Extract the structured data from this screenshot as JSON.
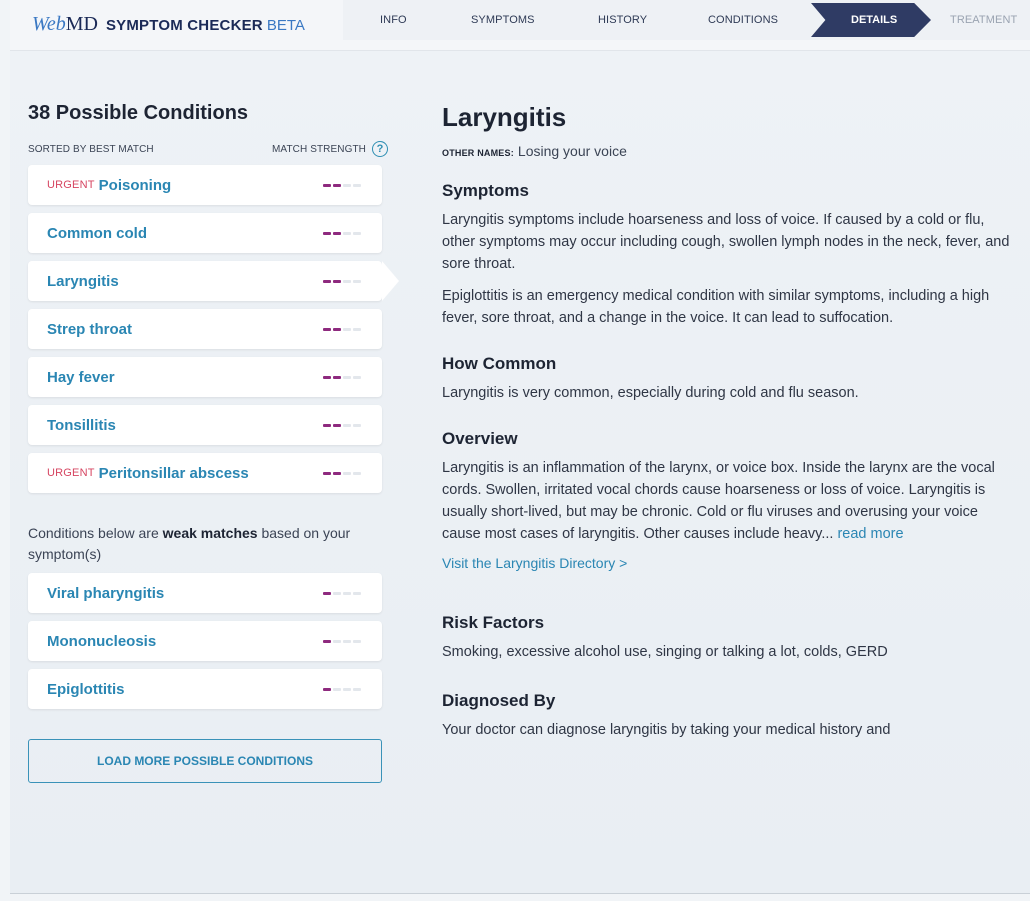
{
  "header": {
    "brand_web": "Web",
    "brand_md": "MD",
    "brand_product": "SYMPTOM CHECKER",
    "brand_beta": "BETA",
    "steps": [
      "INFO",
      "SYMPTOMS",
      "HISTORY",
      "CONDITIONS",
      "DETAILS",
      "TREATMENT"
    ],
    "active_step": "DETAILS"
  },
  "left": {
    "title": "38 Possible Conditions",
    "sorted_label": "SORTED BY BEST MATCH",
    "match_label": "MATCH STRENGTH",
    "help_glyph": "?",
    "strong_matches": [
      {
        "urgent": "URGENT",
        "name": "Poisoning",
        "strength": 2
      },
      {
        "urgent": "",
        "name": "Common cold",
        "strength": 2
      },
      {
        "urgent": "",
        "name": "Laryngitis",
        "strength": 2,
        "selected": true
      },
      {
        "urgent": "",
        "name": "Strep throat",
        "strength": 2
      },
      {
        "urgent": "",
        "name": "Hay fever",
        "strength": 2
      },
      {
        "urgent": "",
        "name": "Tonsillitis",
        "strength": 2
      },
      {
        "urgent": "URGENT",
        "name": "Peritonsillar abscess",
        "strength": 2
      }
    ],
    "weak_note_pre": "Conditions below are ",
    "weak_note_bold": "weak matches",
    "weak_note_post": " based on your symptom(s)",
    "weak_matches": [
      {
        "name": "Viral pharyngitis",
        "strength": 1
      },
      {
        "name": "Mononucleosis",
        "strength": 1
      },
      {
        "name": "Epiglottitis",
        "strength": 1
      }
    ],
    "load_more": "LOAD MORE POSSIBLE CONDITIONS"
  },
  "detail": {
    "title": "Laryngitis",
    "other_names_label": "OTHER NAMES:",
    "other_names": "Losing your voice",
    "symptoms_heading": "Symptoms",
    "symptoms_p1": "Laryngitis symptoms include hoarseness and loss of voice. If caused by a cold or flu, other symptoms may occur including cough, swollen lymph nodes in the neck, fever, and sore throat.",
    "symptoms_p2": "Epiglottitis is an emergency medical condition with similar symptoms, including a high fever, sore throat, and a change in the voice. It can lead to suffocation.",
    "common_heading": "How Common",
    "common_p": "Laryngitis is very common, especially during cold and flu season.",
    "overview_heading": "Overview",
    "overview_p": "Laryngitis is an inflammation of the larynx, or voice box. Inside the larynx are the vocal cords. Swollen, irritated vocal chords cause hoarseness or loss of voice. Laryngitis is usually short-lived, but may be chronic. Cold or flu viruses and overusing your voice cause most cases of laryngitis. Other causes include heavy...",
    "read_more": "read more",
    "directory_link": "Visit the Laryngitis Directory >",
    "risk_heading": "Risk Factors",
    "risk_p": "Smoking, excessive alcohol use, singing or talking a lot, colds, GERD",
    "diag_heading": "Diagnosed By",
    "diag_p": "Your doctor can diagnose laryngitis by taking your medical history and"
  }
}
